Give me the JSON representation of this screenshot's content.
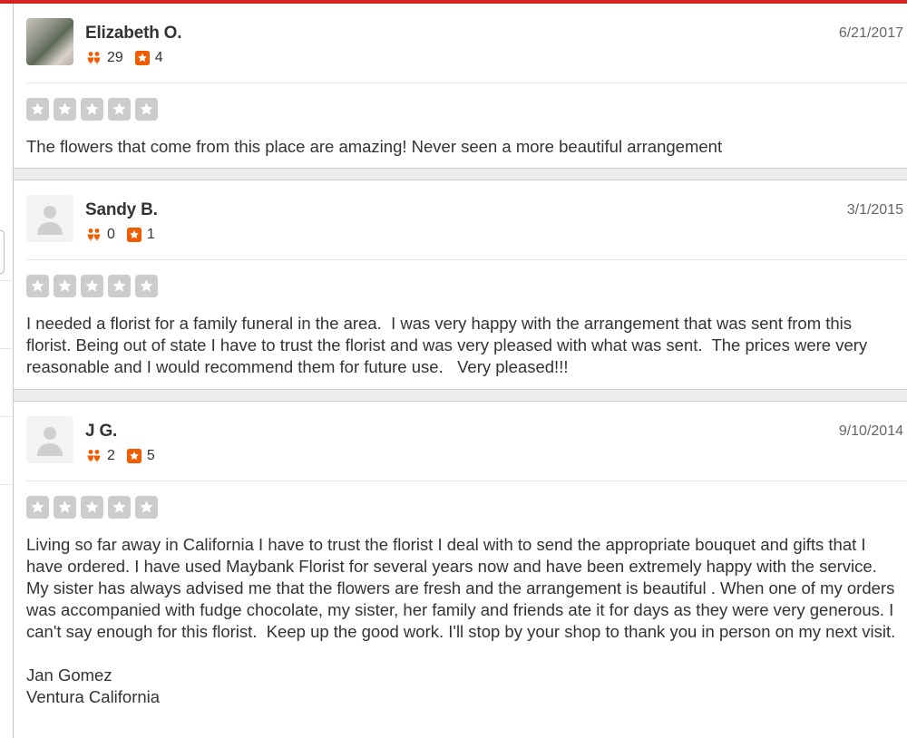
{
  "colors": {
    "accent": "#d32323",
    "star_empty": "#cccccc",
    "badge_orange": "#f15c00"
  },
  "reviews": [
    {
      "user": "Elizabeth O.",
      "avatar": "user-photo",
      "friends": "29",
      "reviews_count": "4",
      "date": "6/21/2017",
      "rating": 0,
      "text": [
        "The flowers that come from this place are amazing! Never seen a more beautiful arrangement"
      ],
      "signature": []
    },
    {
      "user": "Sandy B.",
      "avatar": "default-user-icon",
      "friends": "0",
      "reviews_count": "1",
      "date": "3/1/2015",
      "rating": 0,
      "text": [
        "I needed a florist for a family funeral in the area.  I was very happy with the arrangement that was sent from this florist. Being out of state I have to trust the florist and was very pleased with what was sent.  The prices were very reasonable and I would recommend them for future use.   Very pleased!!!"
      ],
      "signature": []
    },
    {
      "user": "J G.",
      "avatar": "default-user-icon",
      "friends": "2",
      "reviews_count": "5",
      "date": "9/10/2014",
      "rating": 0,
      "text": [
        "Living so far away in California I have to trust the florist I deal with to send the appropriate bouquet and gifts that I have ordered. I have used Maybank Florist for several years now and have been extremely happy with the service. My sister has always advised me that the flowers are fresh and the arrangement is beautiful . When one of my orders was accompanied with fudge chocolate, my sister, her family and friends ate it for days as they were very generous. I can't say enough for this florist.  Keep up the good work. I'll stop by your shop to thank you in person on my next visit."
      ],
      "signature": [
        "Jan Gomez",
        "Ventura California"
      ]
    }
  ]
}
